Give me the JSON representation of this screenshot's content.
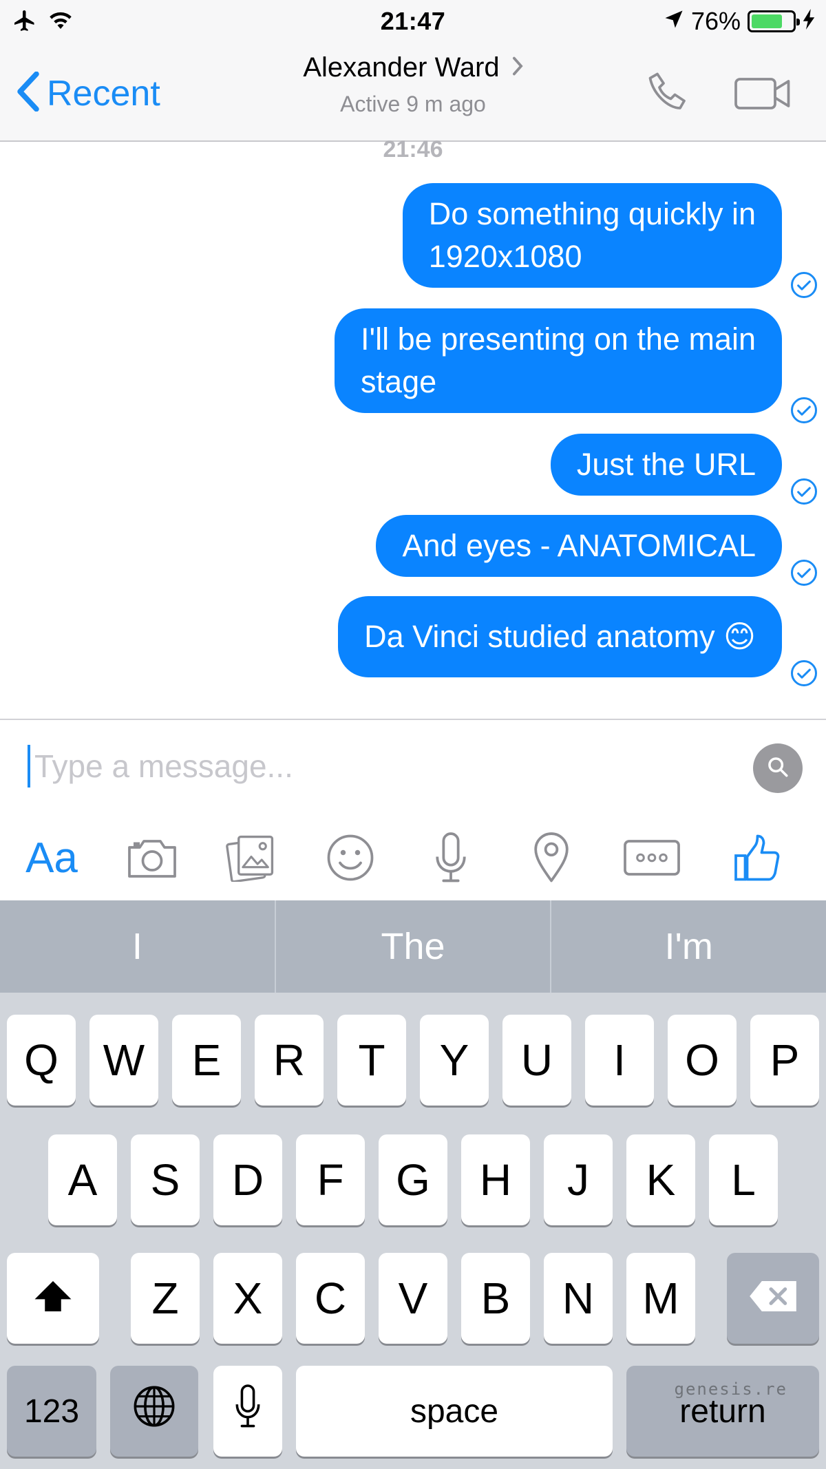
{
  "status_bar": {
    "time": "21:47",
    "battery_percent": "76%",
    "battery_level": 0.76
  },
  "nav": {
    "back_label": "Recent",
    "title": "Alexander Ward",
    "subtitle": "Active 9 m ago"
  },
  "chat": {
    "timestamp": "21:46",
    "messages": [
      {
        "lines": [
          "Do something quickly in",
          "1920x1080"
        ],
        "status": "sent"
      },
      {
        "lines": [
          "I'll be presenting on the main",
          "stage"
        ],
        "status": "sent"
      },
      {
        "lines": [
          "Just the URL"
        ],
        "status": "sent"
      },
      {
        "lines": [
          "And eyes - ANATOMICAL"
        ],
        "status": "sent"
      },
      {
        "lines": [
          "Da Vinci studied anatomy 😊"
        ],
        "status": "sent"
      }
    ]
  },
  "composer": {
    "placeholder": "Type a message...",
    "toolbar": {
      "text_label": "Aa",
      "icons": [
        "camera-icon",
        "gallery-icon",
        "emoji-icon",
        "microphone-icon",
        "location-icon",
        "more-icon",
        "like-icon"
      ]
    }
  },
  "predictive": [
    "I",
    "The",
    "I'm"
  ],
  "keyboard": {
    "row1": [
      "Q",
      "W",
      "E",
      "R",
      "T",
      "Y",
      "U",
      "I",
      "O",
      "P"
    ],
    "row2": [
      "A",
      "S",
      "D",
      "F",
      "G",
      "H",
      "J",
      "K",
      "L"
    ],
    "row3": [
      "Z",
      "X",
      "C",
      "V",
      "B",
      "N",
      "M"
    ],
    "numbers_label": "123",
    "space_label": "space",
    "return_label": "return"
  },
  "watermark": "genesis.re",
  "colors": {
    "accent": "#1a8cf5",
    "bubble": "#0a84ff",
    "battery": "#4cd964"
  }
}
